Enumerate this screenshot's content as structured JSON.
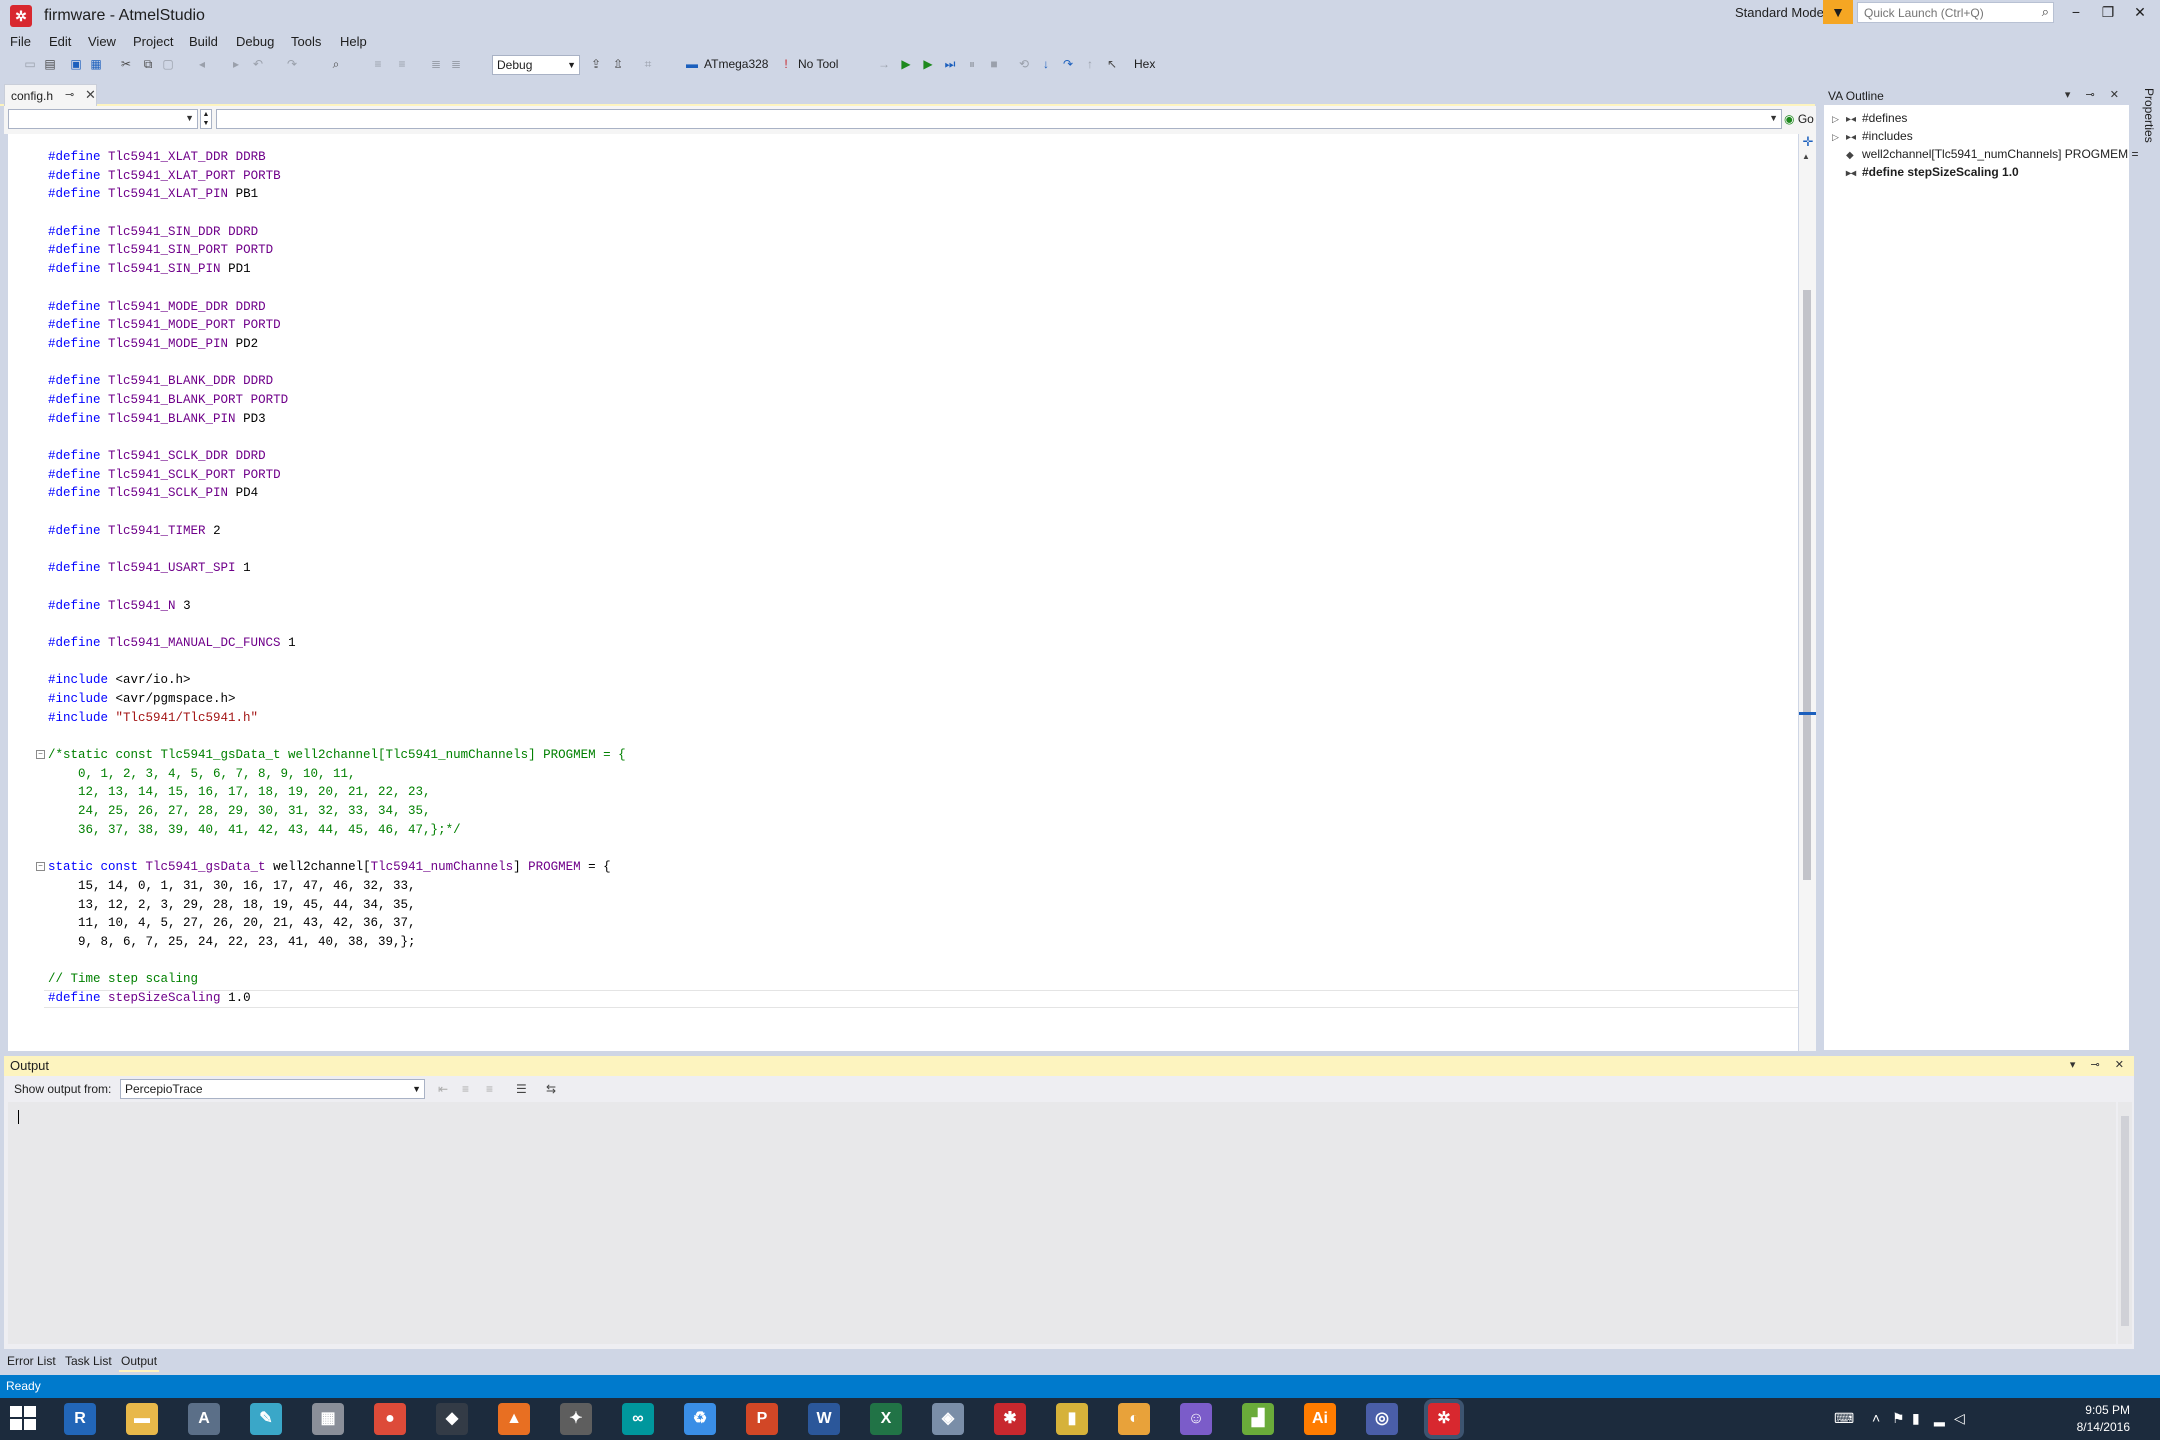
{
  "window": {
    "title": "firmware - AtmelStudio",
    "logo": "atmel-logo",
    "mode": "Standard Mode",
    "quick_launch_placeholder": "Quick Launch (Ctrl+Q)",
    "minimize": "−",
    "maximize": "❐",
    "close": "✕"
  },
  "menu": [
    "File",
    "Edit",
    "View",
    "Project",
    "Build",
    "Debug",
    "Tools",
    "Help"
  ],
  "toolbar": {
    "config": "Debug",
    "device": "ATmega328",
    "tool": "No Tool",
    "hex": "Hex"
  },
  "tabs": [
    {
      "label": "config.h",
      "pin": "⊸",
      "close": "✕"
    }
  ],
  "navbar": {
    "go_label": "Go"
  },
  "code_lines": [
    {
      "t": "define",
      "macro": "Tlc5941_XLAT_DDR",
      "value": "DDRB",
      "value_class": "mac"
    },
    {
      "t": "define",
      "macro": "Tlc5941_XLAT_PORT",
      "value": "PORTB",
      "value_class": "mac"
    },
    {
      "t": "define",
      "macro": "Tlc5941_XLAT_PIN",
      "value": "PB1",
      "value_class": "plain"
    },
    {
      "t": "blank"
    },
    {
      "t": "define",
      "macro": "Tlc5941_SIN_DDR",
      "value": "DDRD",
      "value_class": "mac"
    },
    {
      "t": "define",
      "macro": "Tlc5941_SIN_PORT",
      "value": "PORTD",
      "value_class": "mac"
    },
    {
      "t": "define",
      "macro": "Tlc5941_SIN_PIN",
      "value": "PD1",
      "value_class": "plain"
    },
    {
      "t": "blank"
    },
    {
      "t": "define",
      "macro": "Tlc5941_MODE_DDR",
      "value": "DDRD",
      "value_class": "mac"
    },
    {
      "t": "define",
      "macro": "Tlc5941_MODE_PORT",
      "value": "PORTD",
      "value_class": "mac"
    },
    {
      "t": "define",
      "macro": "Tlc5941_MODE_PIN",
      "value": "PD2",
      "value_class": "plain"
    },
    {
      "t": "blank"
    },
    {
      "t": "define",
      "macro": "Tlc5941_BLANK_DDR",
      "value": "DDRD",
      "value_class": "mac"
    },
    {
      "t": "define",
      "macro": "Tlc5941_BLANK_PORT",
      "value": "PORTD",
      "value_class": "mac"
    },
    {
      "t": "define",
      "macro": "Tlc5941_BLANK_PIN",
      "value": "PD3",
      "value_class": "plain"
    },
    {
      "t": "blank"
    },
    {
      "t": "define",
      "macro": "Tlc5941_SCLK_DDR",
      "value": "DDRD",
      "value_class": "mac"
    },
    {
      "t": "define",
      "macro": "Tlc5941_SCLK_PORT",
      "value": "PORTD",
      "value_class": "mac"
    },
    {
      "t": "define",
      "macro": "Tlc5941_SCLK_PIN",
      "value": "PD4",
      "value_class": "plain"
    },
    {
      "t": "blank"
    },
    {
      "t": "define",
      "macro": "Tlc5941_TIMER",
      "value": "2",
      "value_class": "plain"
    },
    {
      "t": "blank"
    },
    {
      "t": "define",
      "macro": "Tlc5941_USART_SPI",
      "value": "1",
      "value_class": "plain"
    },
    {
      "t": "blank"
    },
    {
      "t": "define",
      "macro": "Tlc5941_N",
      "value": "3",
      "value_class": "plain"
    },
    {
      "t": "blank"
    },
    {
      "t": "define",
      "macro": "Tlc5941_MANUAL_DC_FUNCS",
      "value": "1",
      "value_class": "plain"
    },
    {
      "t": "blank"
    },
    {
      "t": "include",
      "path": "<avr/io.h>",
      "path_class": "plain"
    },
    {
      "t": "include",
      "path": "<avr/pgmspace.h>",
      "path_class": "plain"
    },
    {
      "t": "include",
      "path": "\"Tlc5941/Tlc5941.h\"",
      "path_class": "str"
    },
    {
      "t": "blank"
    },
    {
      "t": "comment",
      "text": "/*static const Tlc5941_gsData_t well2channel[Tlc5941_numChannels] PROGMEM = {",
      "fold": true
    },
    {
      "t": "comment",
      "text": "    0, 1, 2, 3, 4, 5, 6, 7, 8, 9, 10, 11,"
    },
    {
      "t": "comment",
      "text": "    12, 13, 14, 15, 16, 17, 18, 19, 20, 21, 22, 23,"
    },
    {
      "t": "comment",
      "text": "    24, 25, 26, 27, 28, 29, 30, 31, 32, 33, 34, 35,"
    },
    {
      "t": "comment",
      "text": "    36, 37, 38, 39, 40, 41, 42, 43, 44, 45, 46, 47,};*/"
    },
    {
      "t": "blank"
    },
    {
      "t": "decl",
      "kw": "static const",
      "type": "Tlc5941_gsData_t",
      "name": "well2channel[",
      "macro": "Tlc5941_numChannels",
      "tail": "] ",
      "prog": "PROGMEM",
      "end": " = {",
      "fold": true
    },
    {
      "t": "plain",
      "text": "    15, 14, 0, 1, 31, 30, 16, 17, 47, 46, 32, 33,"
    },
    {
      "t": "plain",
      "text": "    13, 12, 2, 3, 29, 28, 18, 19, 45, 44, 34, 35,"
    },
    {
      "t": "plain",
      "text": "    11, 10, 4, 5, 27, 26, 20, 21, 43, 42, 36, 37,"
    },
    {
      "t": "plain",
      "text": "    9, 8, 6, 7, 25, 24, 22, 23, 41, 40, 38, 39,};"
    },
    {
      "t": "blank"
    },
    {
      "t": "comment",
      "text": "// Time step scaling"
    },
    {
      "t": "define",
      "macro": "stepSizeScaling",
      "value": "1.0",
      "value_class": "plain",
      "current": true
    }
  ],
  "va_outline": {
    "title": "VA Outline",
    "header_buttons": "▾ ⊸ ✕",
    "items": [
      {
        "label": "#defines",
        "bold": false,
        "arrow": "▷",
        "icon": "▸◂"
      },
      {
        "label": "#includes",
        "bold": false,
        "arrow": "▷",
        "icon": "▸◂"
      },
      {
        "label": "well2channel[Tlc5941_numChannels] PROGMEM =",
        "bold": false,
        "arrow": "",
        "icon": "◆"
      },
      {
        "label": "#define stepSizeScaling 1.0",
        "bold": true,
        "arrow": "",
        "icon": "▸◂"
      }
    ]
  },
  "properties_tab": "Properties",
  "output": {
    "title": "Output",
    "header_buttons": "▾ ⊸ ✕",
    "show_from_label": "Show output from:",
    "source": "PercepioTrace"
  },
  "bottom_tabs": [
    "Error List",
    "Task List",
    "Output"
  ],
  "status": "Ready",
  "clock": {
    "time": "9:05 PM",
    "date": "8/14/2016"
  },
  "taskbar_apps": [
    {
      "name": "r-icon",
      "glyph": "R",
      "color": "#2266b8"
    },
    {
      "name": "file-explorer-icon",
      "glyph": "▬",
      "color": "#e8b84a"
    },
    {
      "name": "cortana-icon",
      "glyph": "A",
      "color": "#5b6f88"
    },
    {
      "name": "notes-icon",
      "glyph": "✎",
      "color": "#3aa7c8"
    },
    {
      "name": "calculator-icon",
      "glyph": "▦",
      "color": "#8a8f99"
    },
    {
      "name": "chrome-icon",
      "glyph": "●",
      "color": "#dd4b39"
    },
    {
      "name": "inkscape-icon",
      "glyph": "◆",
      "color": "#333b46"
    },
    {
      "name": "matlab-icon",
      "glyph": "▲",
      "color": "#e86f22"
    },
    {
      "name": "gimp-icon",
      "glyph": "✦",
      "color": "#5e5e5e"
    },
    {
      "name": "arduino-icon",
      "glyph": "∞",
      "color": "#00979d"
    },
    {
      "name": "recycle-icon",
      "glyph": "♻",
      "color": "#3a8ee6"
    },
    {
      "name": "powerpoint-icon",
      "glyph": "P",
      "color": "#d24726"
    },
    {
      "name": "word-icon",
      "glyph": "W",
      "color": "#2b579a"
    },
    {
      "name": "excel-icon",
      "glyph": "X",
      "color": "#217346"
    },
    {
      "name": "vs-installer-icon",
      "glyph": "◈",
      "color": "#7a8ea8"
    },
    {
      "name": "solidworks-icon",
      "glyph": "✱",
      "color": "#c8282e"
    },
    {
      "name": "usb-drive-icon",
      "glyph": "▮",
      "color": "#d6b23a"
    },
    {
      "name": "weather-icon",
      "glyph": "◐",
      "color": "#e8a23a"
    },
    {
      "name": "github-icon",
      "glyph": "☺",
      "color": "#7b5cc9"
    },
    {
      "name": "chart-app-icon",
      "glyph": "▟",
      "color": "#6aab3a"
    },
    {
      "name": "illustrator-icon",
      "glyph": "Ai",
      "color": "#ff7c00"
    },
    {
      "name": "eclipse-icon",
      "glyph": "◎",
      "color": "#4a5ea8"
    },
    {
      "name": "atmel-studio-icon",
      "glyph": "✲",
      "color": "#d8282f"
    }
  ]
}
